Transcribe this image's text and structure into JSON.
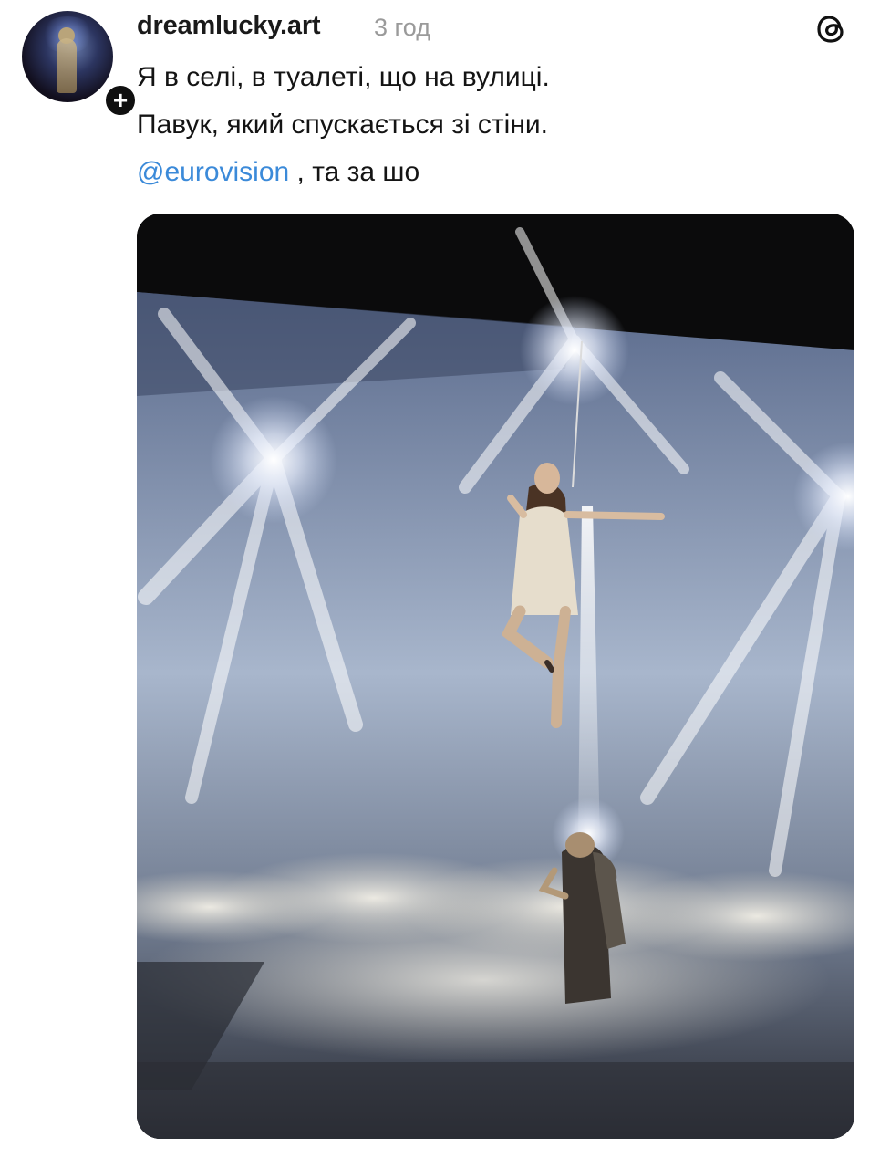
{
  "post": {
    "username": "dreamlucky.art",
    "timestamp": "3 год",
    "follow_symbol": "+",
    "text_lines": [
      "Я в селі, в туалеті, що на вулиці.",
      "Павук, який спускається зі стіни."
    ],
    "mention": "@eurovision",
    "mention_suffix": " , та за шо"
  },
  "icons": {
    "app": "threads-icon",
    "avatar": "avatar",
    "follow": "follow-plus-icon"
  },
  "colors": {
    "mention": "#3b8ad9",
    "text": "#141414",
    "timestamp": "#9a9a9a"
  }
}
